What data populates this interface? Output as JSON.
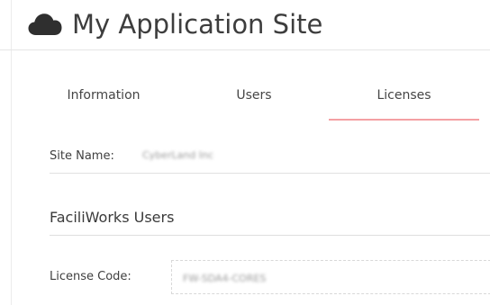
{
  "header": {
    "title": "My Application Site",
    "icon": "cloud-icon"
  },
  "tabs": [
    {
      "label": "Information",
      "active": false
    },
    {
      "label": "Users",
      "active": false
    },
    {
      "label": "Licenses",
      "active": true
    }
  ],
  "site": {
    "name_label": "Site Name:",
    "name_value": "CyberLand Inc"
  },
  "section": {
    "title": "FaciliWorks Users"
  },
  "license": {
    "code_label": "License Code:",
    "code_value": "FW-SDA4-CORES"
  },
  "colors": {
    "active_tab_underline": "#f4a0a3",
    "text": "#333333",
    "divider": "#e1e1e1"
  }
}
